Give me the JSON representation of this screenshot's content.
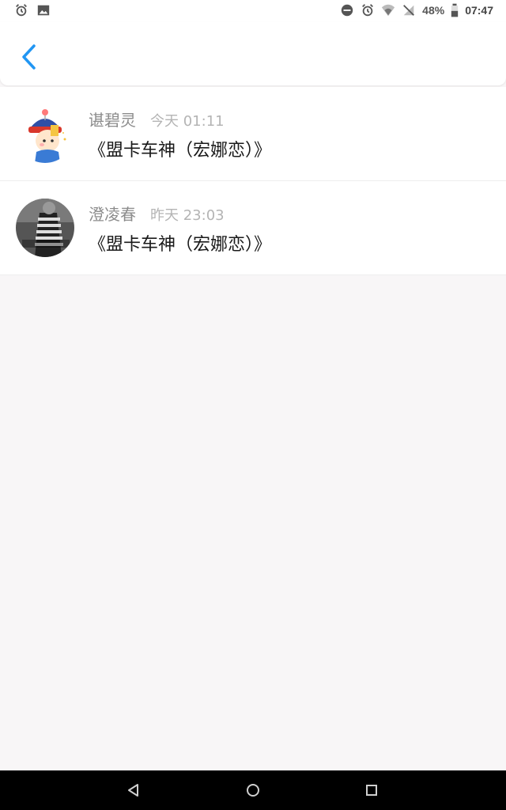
{
  "status_bar": {
    "battery": "48%",
    "time": "07:47",
    "left_icons": [
      "alarm-icon",
      "image-icon"
    ],
    "right_icons": [
      "do-not-disturb-icon",
      "alarm-icon",
      "wifi-icon",
      "no-signal-icon",
      "battery-icon"
    ]
  },
  "header": {
    "back_icon": "chevron-left-icon",
    "accent_color": "#2196f3"
  },
  "items": [
    {
      "author": "谌碧灵",
      "time": "今天 01:11",
      "title": "《盟卡车神（宏娜恋）》"
    },
    {
      "author": "澄凌春",
      "time": "昨天 23:03",
      "title": "《盟卡车神（宏娜恋）》"
    }
  ],
  "nav": {
    "back": "triangle-back-icon",
    "home": "circle-home-icon",
    "recents": "square-recents-icon"
  }
}
